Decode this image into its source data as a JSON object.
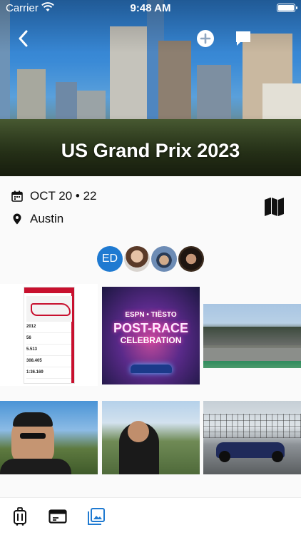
{
  "status_bar": {
    "carrier": "Carrier",
    "time": "9:48 AM"
  },
  "trip": {
    "title": "US Grand Prix 2023",
    "dates": "OCT 20 • 22",
    "location": "Austin"
  },
  "header_actions": {
    "back_icon": "chevron-left-icon",
    "add_icon": "plus-circle-icon",
    "chat_icon": "chat-bubble-icon"
  },
  "participants": [
    {
      "type": "initials",
      "label": "ED"
    },
    {
      "type": "photo"
    },
    {
      "type": "photo"
    },
    {
      "type": "photo"
    }
  ],
  "photos": {
    "p2_line1": "ESPN • TIËSTO",
    "p2_line2": "POST-RACE",
    "p2_line3": "CELEBRATION",
    "p1_stats": [
      "2012",
      "56",
      "5.513",
      "308.405",
      "1:36.169"
    ]
  },
  "tab_bar": {
    "items": [
      {
        "name": "trip",
        "icon": "suitcase-icon"
      },
      {
        "name": "details",
        "icon": "card-icon"
      },
      {
        "name": "photos",
        "icon": "photos-icon",
        "selected": true
      }
    ],
    "active_color": "#1f7ad1",
    "inactive_color": "#111111"
  },
  "colors": {
    "accent": "#1f7ad1"
  }
}
